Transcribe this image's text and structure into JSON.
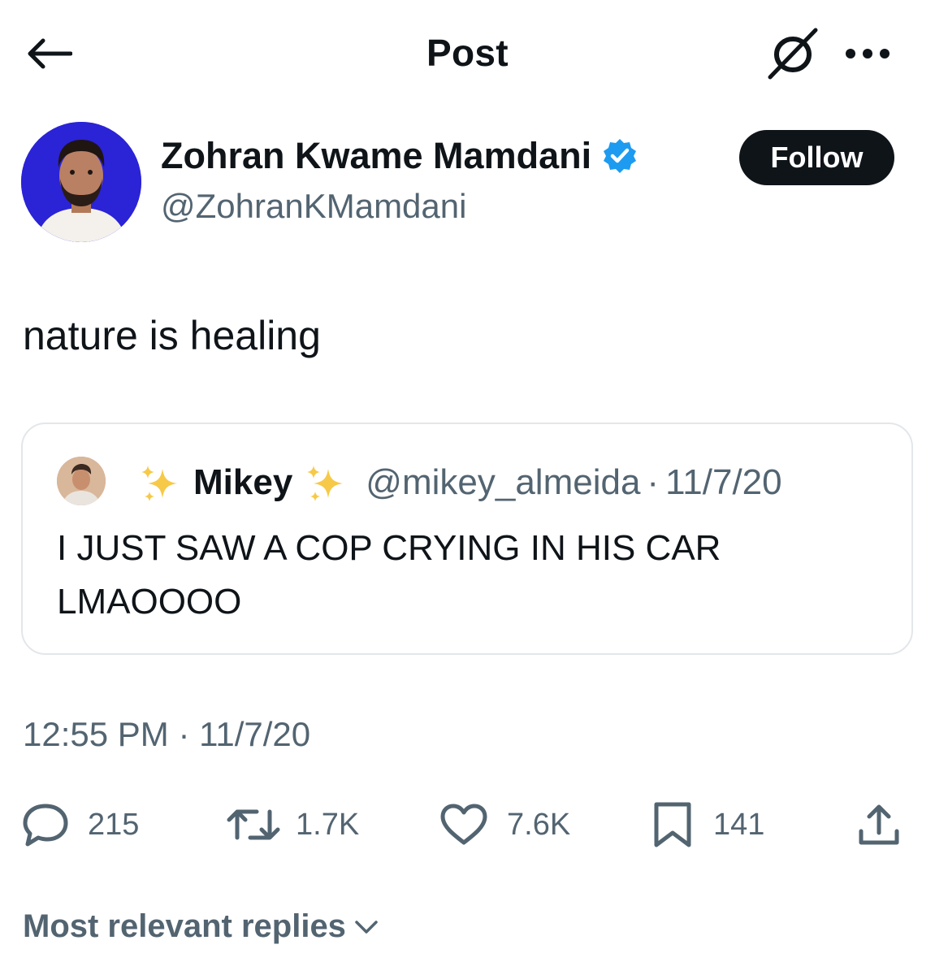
{
  "header": {
    "title": "Post",
    "back_icon": "arrow-left-icon",
    "grok_icon": "grok-icon",
    "more_icon": "more-horizontal-icon"
  },
  "author": {
    "display_name": "Zohran Kwame Mamdani",
    "handle": "@ZohranKMamdani",
    "verified": true,
    "avatar_bg": "#2b23d6"
  },
  "follow_label": "Follow",
  "post": {
    "text": "nature is healing",
    "timestamp": "12:55 PM · 11/7/20"
  },
  "quote": {
    "name": "Mikey",
    "handle": "@mikey_almeida",
    "separator": "·",
    "date": "11/7/20",
    "text": "I JUST SAW A COP CRYING IN HIS CAR LMAOOOO"
  },
  "metrics": {
    "replies": "215",
    "reposts": "1.7K",
    "likes": "7.6K",
    "bookmarks": "141"
  },
  "replies_sort_label": "Most relevant replies",
  "colors": {
    "text_primary": "#0f1419",
    "text_secondary": "#536471",
    "verified_blue": "#1d9bf0",
    "border": "#e3e7ea"
  }
}
